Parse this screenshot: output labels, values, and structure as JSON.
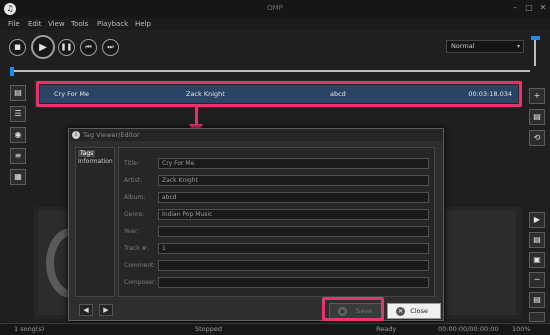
{
  "window": {
    "title": "OMP",
    "minimize": "–",
    "maximize": "□",
    "close": "✕"
  },
  "menu": [
    "File",
    "Edit",
    "View",
    "Tools",
    "Playback",
    "Help"
  ],
  "controls": {
    "stop": "■",
    "play": "▶",
    "pause": "❚❚",
    "prev": "⏮",
    "next": "⏭"
  },
  "mode_select": {
    "value": "Normal",
    "chevron": "▾"
  },
  "track": {
    "title": "Cry For Me",
    "artist": "Zack Knight",
    "album": "abcd",
    "duration": "00:03:18.034"
  },
  "side_left": [
    "▤",
    "☰",
    "◉",
    "≡",
    "▦"
  ],
  "side_right_top": [
    "+",
    "▤",
    "⟲"
  ],
  "side_right_bottom": [
    "▶",
    "▤",
    "▣",
    "─",
    "▤",
    "▣"
  ],
  "dialog": {
    "title": "Tag Viewer/Editor",
    "icon": "i",
    "tree": [
      "Tags",
      "Information"
    ],
    "fields": [
      {
        "label": "Title:",
        "value": "Cry For Me"
      },
      {
        "label": "Artist:",
        "value": "Zack Knight"
      },
      {
        "label": "Album:",
        "value": "abcd"
      },
      {
        "label": "Genre:",
        "value": "Indian Pop Music"
      },
      {
        "label": "Year:",
        "value": ""
      },
      {
        "label": "Track #:",
        "value": "1"
      },
      {
        "label": "Comment:",
        "value": ""
      },
      {
        "label": "Composer:",
        "value": ""
      }
    ],
    "prev": "◀",
    "next": "▶",
    "save_label": "Save",
    "close_label": "Close"
  },
  "status": {
    "songs": "1 song(s)",
    "state": "Stopped",
    "ready": "Ready",
    "time": "00:00:00/00:00:00",
    "zoom": "100%"
  },
  "colors": {
    "accent": "#e8336d",
    "selected_row": "#2a4564",
    "slider": "#1d8ef0"
  }
}
